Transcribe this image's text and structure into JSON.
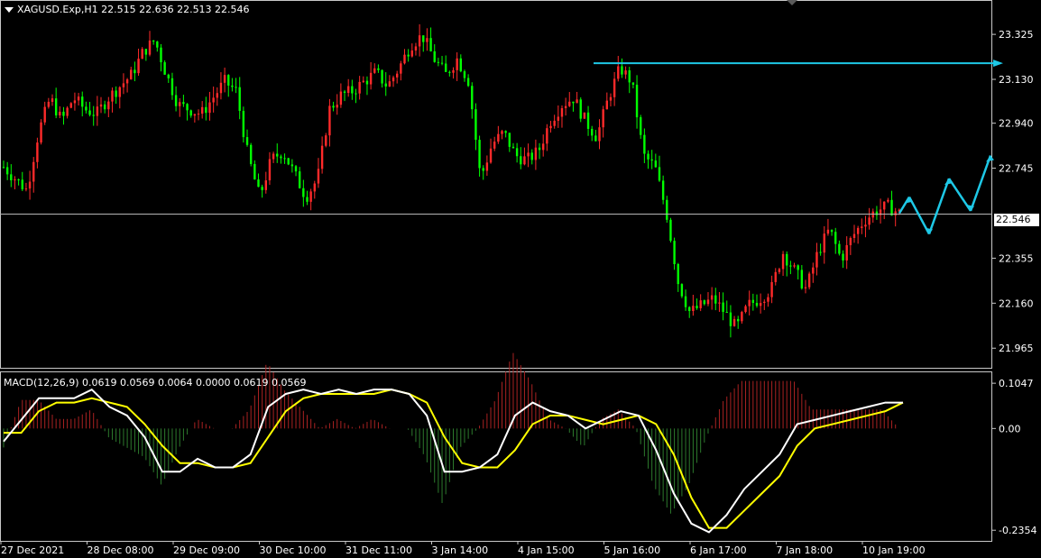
{
  "header": {
    "symbol_info": "XAGUSD.Exp,H1  22.515 22.636 22.513 22.546",
    "macd_info": "MACD(12,26,9) 0.0619 0.0569 0.0064 0.0000 0.0619 0.0569"
  },
  "price_tag": "22.546",
  "chart_data": [
    {
      "type": "candlestick",
      "price_ticks": [
        "23.325",
        "23.130",
        "22.940",
        "22.745",
        "22.355",
        "22.160",
        "21.965"
      ],
      "current_price": 22.546,
      "ylim": [
        21.88,
        23.47
      ],
      "time_labels": [
        "27 Dec 2021",
        "28 Dec 08:00",
        "29 Dec 09:00",
        "30 Dec 10:00",
        "31 Dec 11:00",
        "3 Jan 14:00",
        "4 Jan 15:00",
        "5 Jan 16:00",
        "6 Jan 17:00",
        "7 Jan 18:00",
        "10 Jan 19:00"
      ],
      "up_color": "#ff2a2a",
      "down_color": "#00ff00",
      "close_path": [
        22.75,
        22.7,
        22.65,
        22.9,
        23.05,
        22.95,
        23.05,
        23.0,
        22.98,
        23.05,
        23.1,
        23.15,
        23.25,
        23.3,
        23.15,
        23.02,
        23.0,
        22.98,
        23.05,
        23.12,
        23.08,
        22.8,
        22.62,
        22.78,
        22.82,
        22.72,
        22.62,
        22.7,
        23.0,
        23.06,
        23.08,
        23.12,
        23.16,
        23.1,
        23.18,
        23.28,
        23.32,
        23.22,
        23.15,
        23.22,
        23.12,
        22.7,
        22.85,
        22.9,
        22.8,
        22.78,
        22.82,
        22.95,
        23.02,
        23.05,
        22.95,
        22.88,
        23.05,
        23.18,
        23.12,
        22.8,
        22.75,
        22.55,
        22.25,
        22.12,
        22.15,
        22.18,
        22.12,
        22.05,
        22.15,
        22.18,
        22.22,
        22.38,
        22.3,
        22.22,
        22.38,
        22.48,
        22.35,
        22.45,
        22.52,
        22.56,
        22.58,
        22.55
      ],
      "annotations": {
        "resistance_level": 23.2,
        "projection_path": [
          22.55,
          22.62,
          22.46,
          22.7,
          22.56,
          22.8
        ]
      }
    },
    {
      "type": "line",
      "indicator": "MACD(12,26,9)",
      "ticks": [
        "0.1047",
        "0.00",
        "-0.2354"
      ],
      "ylim": [
        -0.26,
        0.13
      ],
      "macd_color": "#ffffff",
      "signal_color": "#ffff00",
      "hist_pos_color": "#aa2222",
      "hist_neg_color": "#2d7a2d",
      "series": [
        {
          "values": [
            -0.03,
            0.02,
            0.07,
            0.07,
            0.07,
            0.09,
            0.05,
            0.03,
            -0.02,
            -0.1,
            -0.1,
            -0.07,
            -0.09,
            -0.09,
            -0.06,
            0.05,
            0.08,
            0.09,
            0.08,
            0.09,
            0.08,
            0.09,
            0.09,
            0.08,
            0.03,
            -0.1,
            -0.1,
            -0.09,
            -0.06,
            0.03,
            0.06,
            0.04,
            0.03,
            0.0,
            0.02,
            0.04,
            0.03,
            -0.05,
            -0.15,
            -0.22,
            -0.24,
            -0.2,
            -0.14,
            -0.1,
            -0.06,
            0.01,
            0.02,
            0.03,
            0.04,
            0.05,
            0.06,
            0.06
          ]
        },
        {
          "values": [
            -0.01,
            -0.01,
            0.04,
            0.06,
            0.06,
            0.07,
            0.06,
            0.05,
            0.01,
            -0.04,
            -0.08,
            -0.08,
            -0.09,
            -0.09,
            -0.08,
            -0.02,
            0.04,
            0.07,
            0.08,
            0.08,
            0.08,
            0.08,
            0.09,
            0.08,
            0.06,
            -0.02,
            -0.08,
            -0.09,
            -0.09,
            -0.05,
            0.01,
            0.03,
            0.03,
            0.02,
            0.01,
            0.02,
            0.03,
            0.01,
            -0.06,
            -0.16,
            -0.23,
            -0.23,
            -0.19,
            -0.15,
            -0.11,
            -0.04,
            0.0,
            0.01,
            0.02,
            0.03,
            0.04,
            0.06
          ]
        }
      ]
    }
  ]
}
